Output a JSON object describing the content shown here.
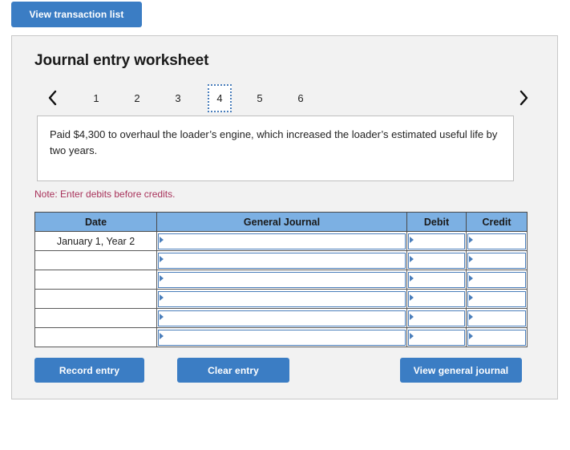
{
  "top_bar": {
    "view_transaction_list_label": "View transaction list"
  },
  "card": {
    "title": "Journal entry worksheet",
    "pagination": {
      "prev_icon": "chevron-left-icon",
      "next_icon": "chevron-right-icon",
      "pages": [
        "1",
        "2",
        "3",
        "4",
        "5",
        "6"
      ],
      "active_page": "4"
    },
    "description": "Paid $4,300 to overhaul the loader’s engine, which increased the loader’s estimated useful life by two years.",
    "note": "Note: Enter debits before credits.",
    "table": {
      "headers": [
        "Date",
        "General Journal",
        "Debit",
        "Credit"
      ],
      "rows": [
        {
          "date": "January 1, Year 2",
          "journal": "",
          "debit": "",
          "credit": ""
        },
        {
          "date": "",
          "journal": "",
          "debit": "",
          "credit": ""
        },
        {
          "date": "",
          "journal": "",
          "debit": "",
          "credit": ""
        },
        {
          "date": "",
          "journal": "",
          "debit": "",
          "credit": ""
        },
        {
          "date": "",
          "journal": "",
          "debit": "",
          "credit": ""
        },
        {
          "date": "",
          "journal": "",
          "debit": "",
          "credit": ""
        }
      ]
    },
    "buttons": {
      "record_entry": "Record entry",
      "clear_entry": "Clear entry",
      "view_general_journal": "View general journal"
    }
  },
  "colors": {
    "button_blue": "#3b7dc4",
    "header_blue": "#7cb0e3",
    "input_border_blue": "#4a7ebb",
    "note_red": "#a8325a",
    "card_bg": "#f2f2f2",
    "card_border": "#c8c8c8"
  }
}
